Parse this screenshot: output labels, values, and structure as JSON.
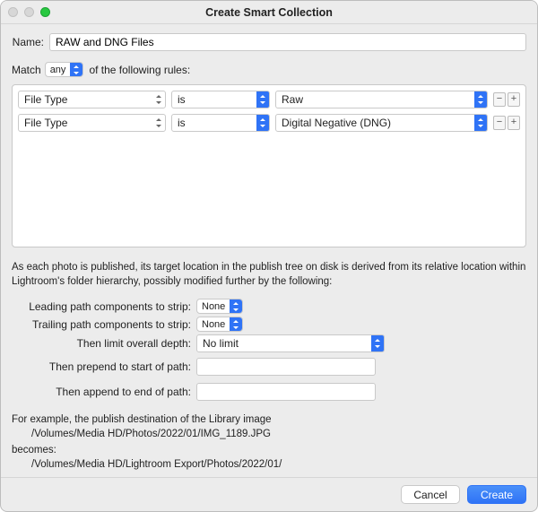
{
  "window": {
    "title": "Create Smart Collection"
  },
  "name": {
    "label": "Name:",
    "value": "RAW and DNG Files"
  },
  "match": {
    "prefix": "Match",
    "mode": "any",
    "suffix": "of the following rules:"
  },
  "rules": [
    {
      "attribute": "File Type",
      "operator": "is",
      "value": "Raw"
    },
    {
      "attribute": "File Type",
      "operator": "is",
      "value": "Digital Negative (DNG)"
    }
  ],
  "publish_desc": "As each photo is published, its target location in the publish tree on disk is derived from its relative location within Lightroom's folder hierarchy, possibly modified further by the following:",
  "options": {
    "leading_label": "Leading path components to strip:",
    "leading_value": "None",
    "trailing_label": "Trailing path components to strip:",
    "trailing_value": "None",
    "depth_label": "Then limit overall depth:",
    "depth_value": "No limit",
    "prepend_label": "Then prepend to start of path:",
    "prepend_value": "",
    "append_label": "Then append to end of path:",
    "append_value": ""
  },
  "example": {
    "intro": "For example, the publish destination of the Library image",
    "source_path": "/Volumes/Media HD/Photos/2022/01/IMG_1189.JPG",
    "becomes": "becomes:",
    "dest_path": "/Volumes/Media HD/Lightroom Export/Photos/2022/01/"
  },
  "buttons": {
    "cancel": "Cancel",
    "create": "Create"
  },
  "glyphs": {
    "minus": "−",
    "plus": "+"
  }
}
